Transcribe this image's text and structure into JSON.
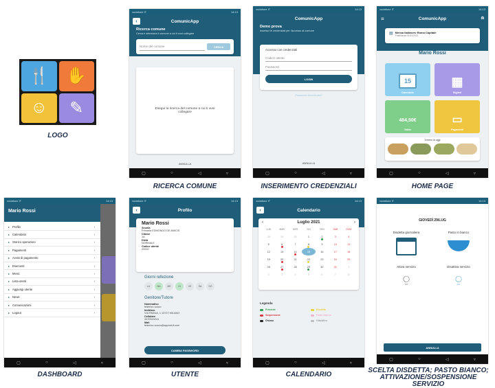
{
  "captions": {
    "logo": "LOGO",
    "search": "RICERCA COMUNE",
    "login": "INSERIMENTO CREDENZIALI",
    "home": "HOME PAGE",
    "dashboard": "DASHBOARD",
    "user": "UTENTE",
    "calendar": "CALENDARIO",
    "choice": "SCELTA DISDETTA; PASTO BIANCO; ATTIVAZIONE/SOSPENSIONE SERVIZIO"
  },
  "status": {
    "carrier": "vodafone IT",
    "time": "14:13"
  },
  "colors": {
    "teal": "#1f5d78",
    "blue_tile": "#8fd0f0",
    "purple_tile": "#a99ae8",
    "green_tile": "#7fcf8a",
    "yellow_tile": "#f0c640",
    "logo_orange": "#f07a3a",
    "logo_blue": "#4da6e0"
  },
  "search": {
    "title": "ComunicApp",
    "heading": "Ricerca comune",
    "subtitle": "Cerca e seleziona il comune a cui ti vuoi collegare",
    "placeholder": "Nome del comune",
    "button": "CERCA",
    "empty": "Esegui la ricerca del comune a cui ti vuoi collegare",
    "cancel": "ANNULLA"
  },
  "login": {
    "title": "ComunicApp",
    "heading": "Demo prova",
    "subtitle": "Inserisci le credenziali per l'accesso al comune",
    "section": "Accesso con credenziali",
    "code_placeholder": "Codice utente",
    "password_placeholder": "Password",
    "button": "LOGIN",
    "forgot": "Password dimenticata?",
    "cancel": "ANNULLA"
  },
  "home": {
    "title": "ComunicApp",
    "school": "Mensa Italiaserv Roma Capitale",
    "school_date": "Fratellanza 01/01/2021",
    "name": "Mario Rossi",
    "calendar_day": "15",
    "calendar_label": "Calendario",
    "menu_label": "Biglieti",
    "balance": "484,50€",
    "balance_label": "Saldo",
    "payments_label": "Pagamenti",
    "meal_title": "Il menù di oggi"
  },
  "dashboard": {
    "name": "Mario Rossi",
    "items": [
      "Profilo",
      "Calendario",
      "Storico operazioni",
      "Pagamenti",
      "Avvisi di pagamento",
      "Esercenti",
      "Menù",
      "Lista utenti",
      "Aggiungi utente",
      "News",
      "Comunicazioni",
      "Logout"
    ]
  },
  "user": {
    "title": "Profilo",
    "name": "Mario Rossi",
    "fields": [
      {
        "k": "Scuola",
        "v": "Primaria EDMONDO DE AMICIS"
      },
      {
        "k": "Classe",
        "v": "1A"
      },
      {
        "k": "Dieta",
        "v": "NORMALE"
      },
      {
        "k": "Codice utente",
        "v": "20002"
      }
    ],
    "days_title": "Giorni refezione",
    "days": [
      "LU",
      "MA",
      "ME",
      "GI",
      "VE",
      "SA",
      "DO"
    ],
    "parent_title": "Genitore/Tutore",
    "parent_fields": [
      {
        "k": "Nominativo",
        "v": "federico cocco"
      },
      {
        "k": "Indirizzo",
        "v": "VIA PADUA, 1 13727 MILANO"
      },
      {
        "k": "Cellulare",
        "v": "3470015241"
      },
      {
        "k": "Mail",
        "v": "federico.cocco@appnet-it.com"
      }
    ],
    "button": "CAMBIA PASSWORD"
  },
  "calendar": {
    "title": "Calendario",
    "month": "Luglio 2021",
    "weekdays": [
      "LUN",
      "MAR",
      "MER",
      "GIO",
      "VEN",
      "SAB",
      "DOM"
    ],
    "days": [
      "28",
      "29",
      "30",
      "1",
      "2",
      "3",
      "4",
      "5",
      "6",
      "7",
      "8",
      "9",
      "10",
      "11",
      "12",
      "13",
      "14",
      "15",
      "16",
      "17",
      "18",
      "19",
      "20",
      "21",
      "22",
      "23",
      "24",
      "25",
      "26",
      "27",
      "28",
      "29",
      "30",
      "31",
      "1",
      "2",
      "3",
      "4",
      "5",
      "6",
      "7",
      "8"
    ],
    "legend_title": "Legenda",
    "legend": [
      {
        "label": "Presente",
        "color": "#2e9e4a"
      },
      {
        "label": "Disdetta",
        "color": "#e8d23a"
      },
      {
        "label": "Sospensione",
        "color": "#d8343f"
      },
      {
        "label": "Pasto bianco",
        "color": "#f2b3c8"
      },
      {
        "label": "Chiuso",
        "color": "#222222"
      },
      {
        "label": "Gita/Altro",
        "color": "#bbbbbb"
      }
    ]
  },
  "choice": {
    "date": "GIOVEDÌ 29/LUG",
    "option1": "Disdetta giornaliera",
    "option2": "Pasto in bianco",
    "option3": "Attiva servizio",
    "option4": "Disattiva servizio",
    "cancel": "ANNULLA"
  }
}
